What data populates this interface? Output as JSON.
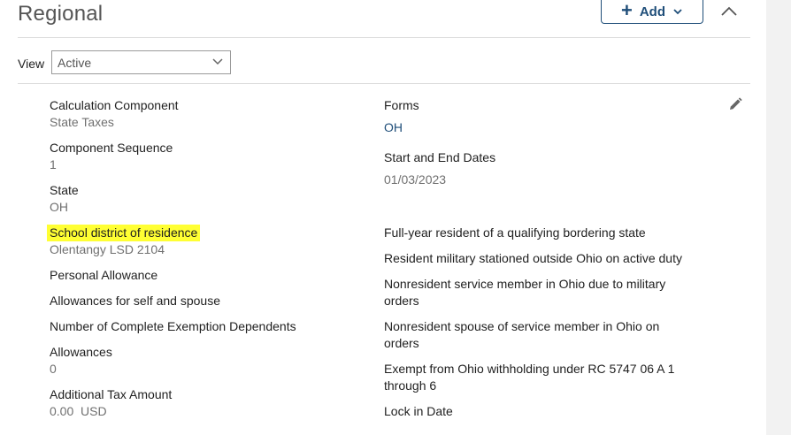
{
  "section": {
    "title": "Regional",
    "add_label": "Add"
  },
  "view": {
    "label": "View",
    "selected": "Active"
  },
  "left_fields": [
    {
      "label": "Calculation Component",
      "value": "State Taxes"
    },
    {
      "label": "Component Sequence",
      "value": "1"
    },
    {
      "label": "State",
      "value": "OH"
    },
    {
      "label": "School district of residence",
      "value": "Olentangy LSD 2104"
    },
    {
      "label": "Personal Allowance",
      "value": ""
    },
    {
      "label": "Allowances for self and spouse",
      "value": ""
    },
    {
      "label": "Number of Complete Exemption Dependents",
      "value": ""
    },
    {
      "label": "Allowances",
      "value": "0"
    },
    {
      "label": "Additional Tax Amount",
      "value": "0.00  USD"
    }
  ],
  "right_fields": [
    {
      "label": "Forms",
      "value": "OH"
    },
    {
      "label": "Start and End Dates",
      "value": "01/03/2023"
    },
    {
      "label": "Full-year resident of a qualifying bordering state"
    },
    {
      "label": "Resident military stationed outside Ohio on active duty"
    },
    {
      "label": "Nonresident service member in Ohio due to military orders"
    },
    {
      "label": "Nonresident spouse of service member in Ohio on orders"
    },
    {
      "label": "Exempt from Ohio withholding under RC 5747 06 A 1 through 6"
    },
    {
      "label": "Lock in Date"
    }
  ],
  "colors": {
    "link": "#1f4e79",
    "highlight": "#ffff33"
  }
}
